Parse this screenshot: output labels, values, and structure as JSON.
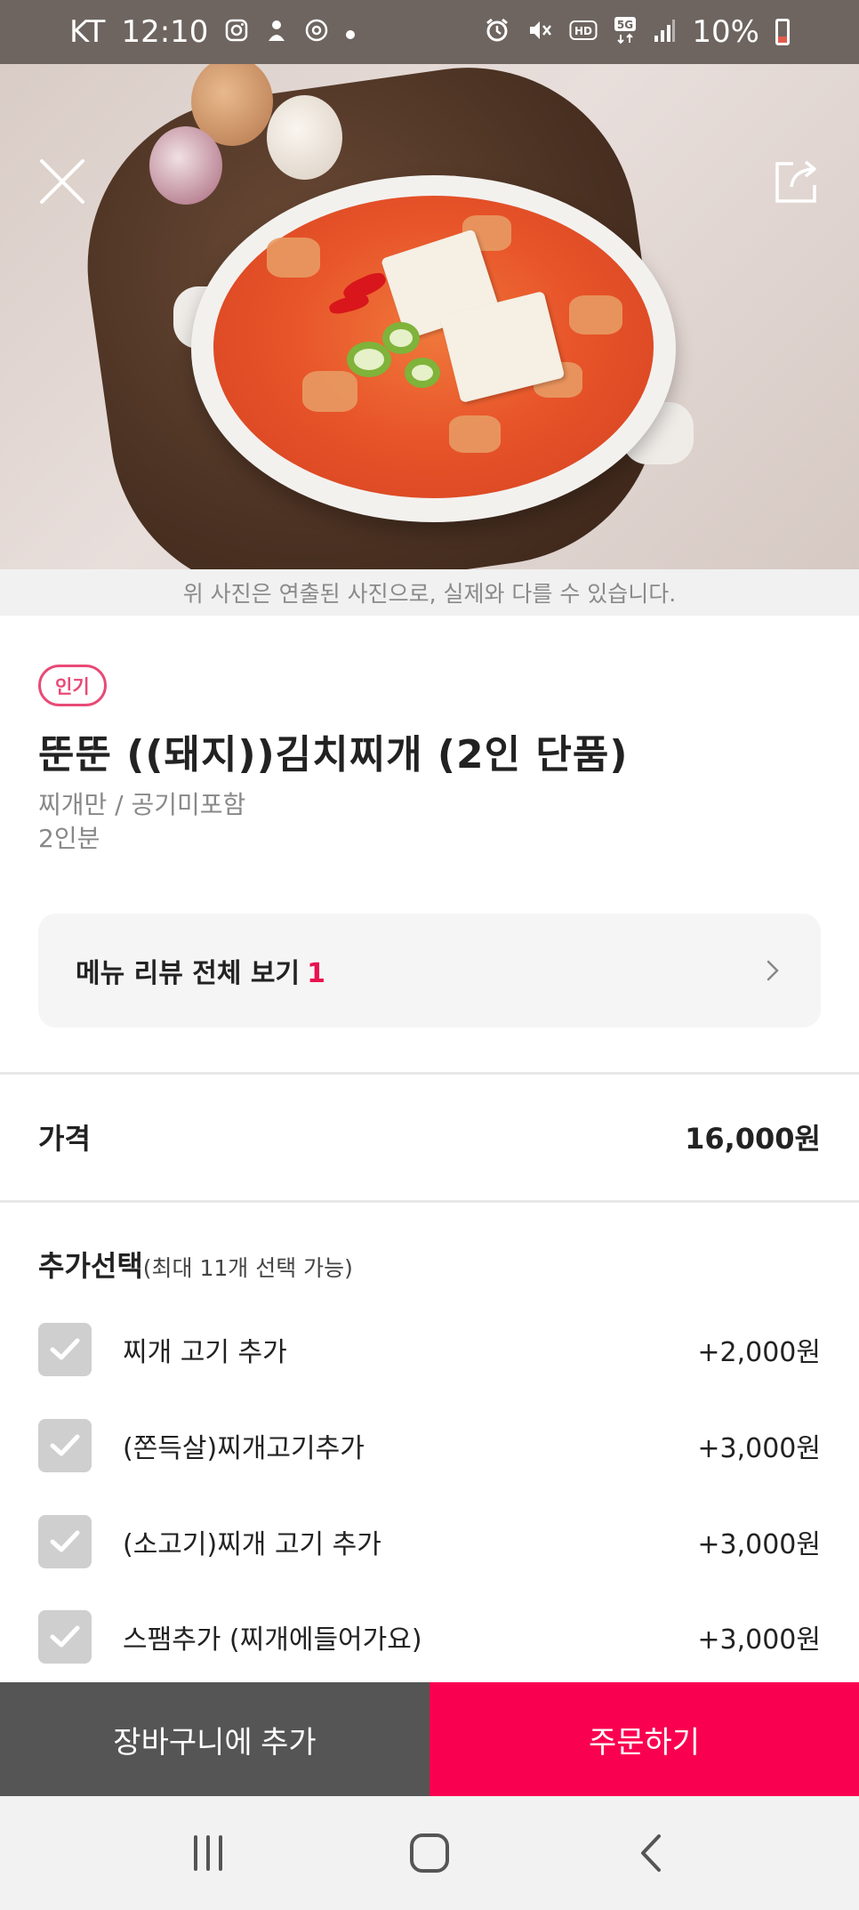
{
  "status_bar": {
    "carrier": "KT",
    "time": "12:10",
    "network": "5G",
    "battery": "10%",
    "left_icons": [
      "instagram-icon",
      "notification-icon",
      "app-icon",
      "dot-icon"
    ],
    "right_icons": [
      "alarm-icon",
      "mute-icon",
      "hd-icon",
      "5g-icon",
      "signal-icon",
      "battery-icon"
    ]
  },
  "hero": {
    "photo_note": "위 사진은 연출된 사진으로, 실제와 다를 수 있습니다."
  },
  "product": {
    "badge": "인기",
    "title": "뚠뚠 ((돼지))김치찌개 (2인 단품)",
    "desc_line1": "찌개만 / 공기미포함",
    "desc_line2": "2인분"
  },
  "review": {
    "label": "메뉴 리뷰 전체 보기",
    "count": "1"
  },
  "price": {
    "label": "가격",
    "value": "16,000원"
  },
  "options": {
    "heading": "추가선택",
    "sub": "(최대 11개 선택 가능)",
    "items": [
      {
        "name": "찌개 고기 추가",
        "price": "+2,000원"
      },
      {
        "name": "(쫀득살)찌개고기추가",
        "price": "+3,000원"
      },
      {
        "name": "(소고기)찌개 고기 추가",
        "price": "+3,000원"
      },
      {
        "name": "스팸추가 (찌개에들어가요)",
        "price": "+3,000원"
      }
    ]
  },
  "actions": {
    "cart": "장바구니에 추가",
    "order": "주문하기"
  },
  "colors": {
    "accent": "#fa0050",
    "cart_button": "#555555",
    "badge": "#e84a76"
  }
}
